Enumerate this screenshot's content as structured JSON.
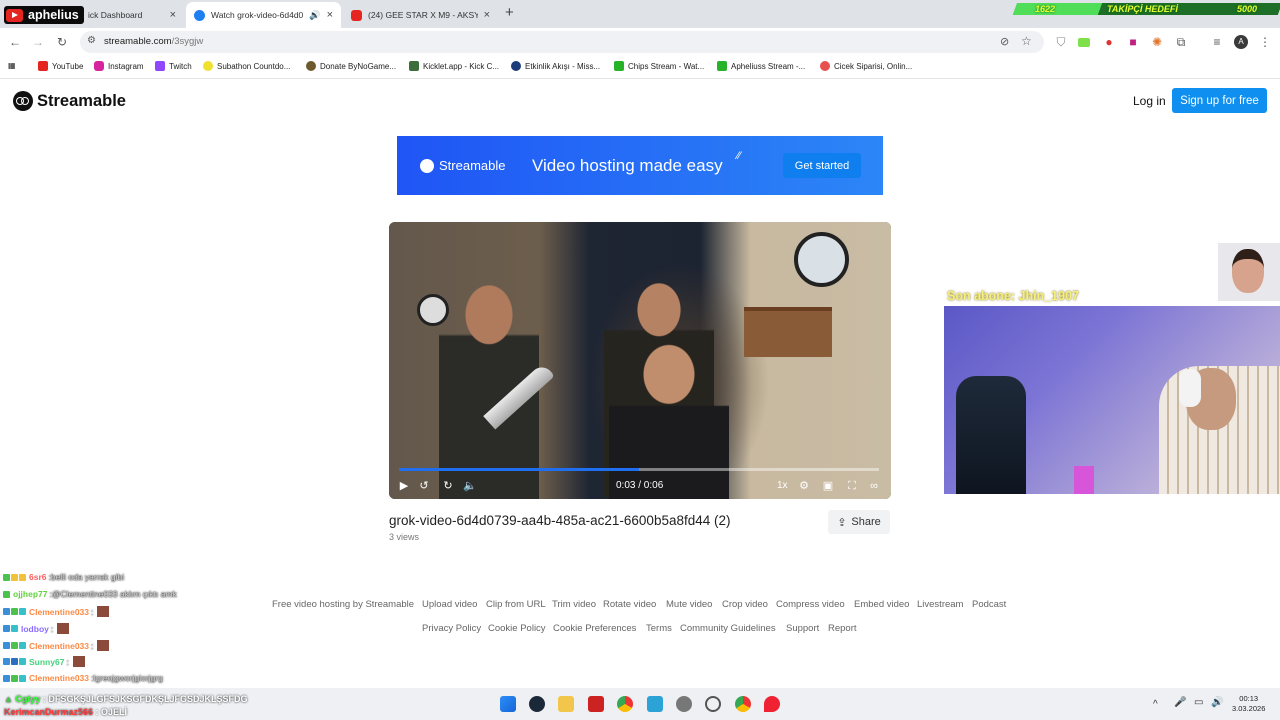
{
  "browser": {
    "tabs": [
      {
        "label": "Kick Dashboard",
        "visible_label": "ick Dashboard",
        "active": false
      },
      {
        "label": "Watch grok-video-6d4d07...",
        "visible_label": "Watch grok-video-6d4d073",
        "active": true
      },
      {
        "label": "(24) GEE STAR X M9 - AKSYON",
        "visible_label": "(24) GEE STAR X M9 - AKSYON",
        "active": false
      }
    ],
    "new_tab": "+",
    "close": "×",
    "url_domain": "streamable.com",
    "url_path": "/3sygjw",
    "bookmarks": [
      "YouTube",
      "Instagram",
      "Twitch",
      "Subathon Countdo...",
      "Donate ByNoGame...",
      "Kicklet.app - Kick C...",
      "Etkinlik Akışı - Miss...",
      "Chips Stream - Wat...",
      "Apheliuss Stream -...",
      "Cicek Siparisi, Onlin..."
    ]
  },
  "stream_overlay": {
    "streamer": "aphelius",
    "follower_goal": {
      "current": "1622",
      "label": "TAKİPÇİ HEDEFİ",
      "target": "5000",
      "progress": 0.32
    },
    "last_subscriber_label": "Son abone: Jhin_1907",
    "chat": [
      {
        "user": "6sr6",
        "color": "#ff5c5c",
        "message": "belli oda yarrak gibi"
      },
      {
        "user": "ojjhep77",
        "color": "#61d23b",
        "message": "@Clementine033 aklım çıktı amk"
      },
      {
        "user": "Clementine033",
        "color": "#ff8a45",
        "message": ""
      },
      {
        "user": "lodboy",
        "color": "#8a6cff",
        "message": ""
      },
      {
        "user": "Clementine033",
        "color": "#ff8a45",
        "message": ""
      },
      {
        "user": "Sunny67",
        "color": "#45d17c",
        "message": ""
      },
      {
        "user": "Clementine033",
        "color": "#ff8a45",
        "message": "lgreojgworjgiorjgrg"
      },
      {
        "user": "Cgtyy",
        "color": "#38ff38",
        "message": "DFSGKŞJLGFSJKSGFDKŞLJFGSDJKLŞSFDG"
      },
      {
        "user": "KerimcanDurmaz566",
        "color": "#ff3c3c",
        "message": "OJELİ"
      }
    ]
  },
  "site": {
    "logo": "Streamable",
    "login": "Log in",
    "signup": "Sign up for free",
    "banner": {
      "brand": "Streamable",
      "tagline": "Video hosting made easy",
      "cta": "Get started"
    },
    "video": {
      "time": "0:03 / 0:06",
      "progress": 0.5,
      "speed": "1x",
      "title": "grok-video-6d4d0739-aa4b-485a-ac21-6600b5a8fd44 (2)",
      "views": "3 views",
      "share": "Share"
    },
    "footer_row1": [
      "Free video hosting by Streamable",
      "Upload video",
      "Clip from URL",
      "Trim video",
      "Rotate video",
      "Mute video",
      "Crop video",
      "Compress video",
      "Embed video",
      "Livestream",
      "Podcast"
    ],
    "footer_row2": [
      "Privacy Policy",
      "Cookie Policy",
      "Cookie Preferences",
      "Terms",
      "Community Guidelines",
      "Support",
      "Report"
    ]
  },
  "taskbar": {
    "time": "00:13",
    "date": "3.03.2026"
  },
  "colors": {
    "accent": "#0f90f0",
    "banner_start": "#1f55f5",
    "banner_end": "#2c86f7",
    "progress": "#1f6ff0"
  }
}
